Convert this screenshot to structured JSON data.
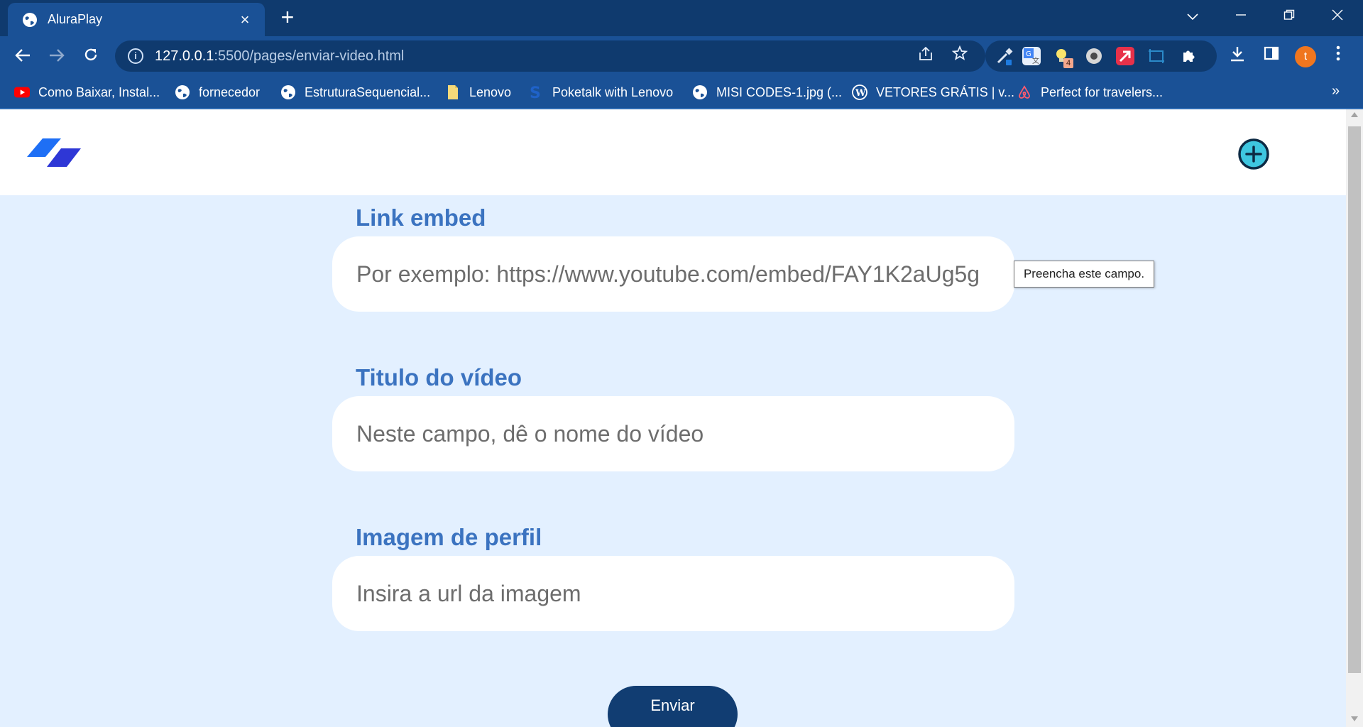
{
  "browser": {
    "tab_title": "AluraPlay",
    "tab_close": "×",
    "new_tab": "+",
    "url_host": "127.0.0.1",
    "url_path": ":5500/pages/enviar-video.html",
    "avatar_letter": "t",
    "extension_badge": "4",
    "bookmarks_more": "»",
    "bookmarks": [
      {
        "label": "Como Baixar, Instal...",
        "icon": "youtube-icon"
      },
      {
        "label": "fornecedor",
        "icon": "globe-icon"
      },
      {
        "label": "EstruturaSequencial...",
        "icon": "globe-icon"
      },
      {
        "label": "Lenovo",
        "icon": "folder-icon"
      },
      {
        "label": "Poketalk with Lenovo",
        "icon": "s-logo-icon"
      },
      {
        "label": "MISI CODES-1.jpg (...",
        "icon": "globe-icon"
      },
      {
        "label": "VETORES GRÁTIS | v...",
        "icon": "wordpress-icon"
      },
      {
        "label": "Perfect for travelers...",
        "icon": "airbnb-icon"
      }
    ]
  },
  "form": {
    "embed": {
      "label": "Link embed",
      "placeholder": "Por exemplo: https://www.youtube.com/embed/FAY1K2aUg5g"
    },
    "title": {
      "label": "Titulo do vídeo",
      "placeholder": "Neste campo, dê o nome do vídeo"
    },
    "image": {
      "label": "Imagem de perfil",
      "placeholder": "Insira a url da imagem"
    },
    "validation_tooltip": "Preencha este campo.",
    "submit_label": "Enviar"
  },
  "colors": {
    "page_bg": "#e3f0ff",
    "label_blue": "#3b73c0",
    "button_navy": "#113d72",
    "chrome_dark": "#0f3a6e",
    "chrome_light": "#1a5196"
  }
}
